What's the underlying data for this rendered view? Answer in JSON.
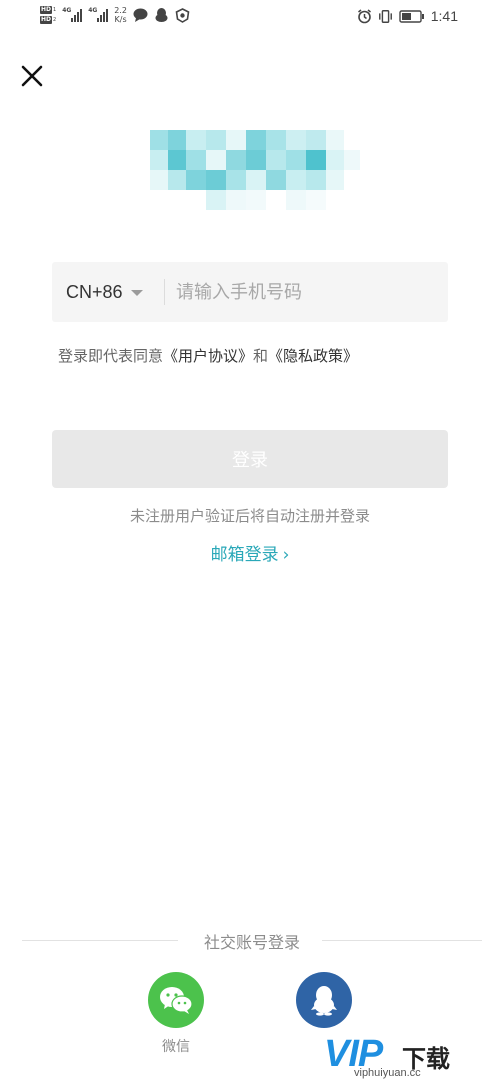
{
  "status_bar": {
    "hd_badges": [
      "HD",
      "HD"
    ],
    "hd_numbers": [
      "1",
      "2"
    ],
    "signal_labels": [
      "4G",
      "4G"
    ],
    "speed_value": "2.2",
    "speed_unit": "K/s",
    "time": "1:41",
    "icons": [
      "speech-bubble-icon",
      "qq-penguin-icon",
      "shield-icon",
      "alarm-icon",
      "vibrate-icon",
      "battery-icon"
    ]
  },
  "phone_login": {
    "country_code": "CN+86",
    "phone_placeholder": "请输入手机号码",
    "phone_value": ""
  },
  "agreement": {
    "prefix": "登录即代表同意",
    "user_agreement": "《用户协议》",
    "and": "和",
    "privacy_policy": "《隐私政策》"
  },
  "login_button": {
    "label": "登录"
  },
  "auto_register_note": "未注册用户验证后将自动注册并登录",
  "email_login": {
    "label": "邮箱登录",
    "chevron": "›"
  },
  "social": {
    "header": "社交账号登录",
    "wechat_label": "微信"
  },
  "watermark": {
    "brand": "VIP",
    "suffix": "下载",
    "url": "viphuiyuan.cc"
  },
  "colors": {
    "accent_teal": "#2aa8b8",
    "wechat_green": "#4cc24c",
    "qq_blue": "#2f64a6",
    "button_disabled": "#e8e8e8"
  }
}
